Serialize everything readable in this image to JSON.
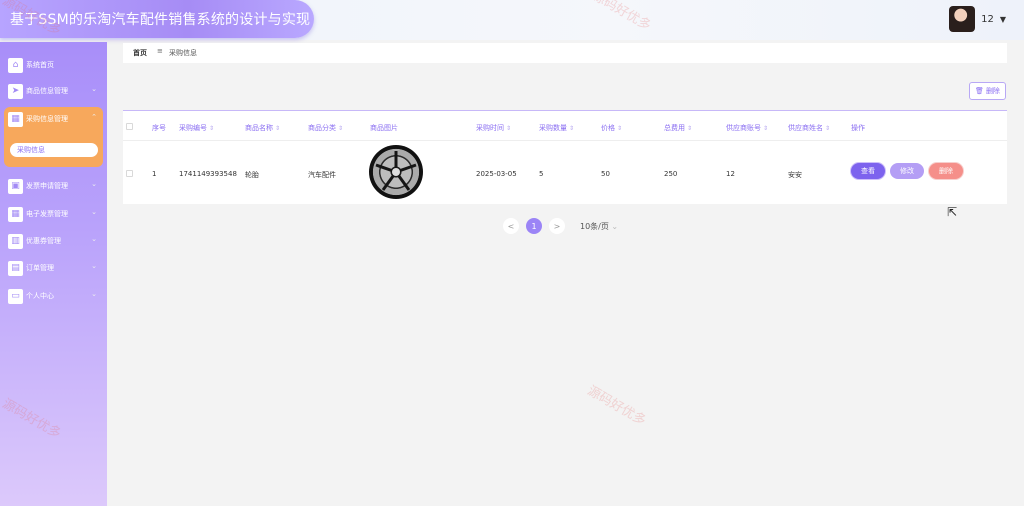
{
  "app": {
    "title": "基于SSM的乐淘汽车配件销售系统的设计与实现",
    "user_name": "12"
  },
  "sidebar": {
    "items": [
      {
        "label": "系统首页",
        "icon": "home-icon"
      },
      {
        "label": "商品信息管理",
        "icon": "send-icon"
      },
      {
        "label": "采购信息管理",
        "icon": "grid-icon"
      },
      {
        "label": "发票申请管理",
        "icon": "briefcase-icon"
      },
      {
        "label": "电子发票管理",
        "icon": "grid-icon"
      },
      {
        "label": "优惠券管理",
        "icon": "bar-chart-icon"
      },
      {
        "label": "订单管理",
        "icon": "wallet-icon"
      },
      {
        "label": "个人中心",
        "icon": "id-card-icon"
      }
    ],
    "active_sub": "采购信息"
  },
  "breadcrumb": {
    "home": "首页",
    "separator": "≡",
    "current": "采购信息"
  },
  "toolbar": {
    "delete_label": "删除"
  },
  "table": {
    "columns": [
      "序号",
      "采购编号",
      "商品名称",
      "商品分类",
      "商品图片",
      "采购时间",
      "采购数量",
      "价格",
      "总费用",
      "供应商账号",
      "供应商姓名",
      "操作"
    ],
    "rows": [
      {
        "index": "1",
        "code": "1741149393548",
        "name": "轮胎",
        "category": "汽车配件",
        "time": "2025-03-05",
        "quantity": "5",
        "price": "50",
        "total": "250",
        "supplier_account": "12",
        "supplier_name": "安安"
      }
    ],
    "actions": {
      "view": "查看",
      "edit": "修改",
      "delete": "删除"
    }
  },
  "pagination": {
    "prev": "<",
    "current": "1",
    "next": ">",
    "page_size": "10条/页"
  },
  "watermark": "源码好优多",
  "colors": {
    "accent": "#8a6ef2",
    "active_menu": "#f7a85c",
    "danger": "#f58f8a"
  }
}
